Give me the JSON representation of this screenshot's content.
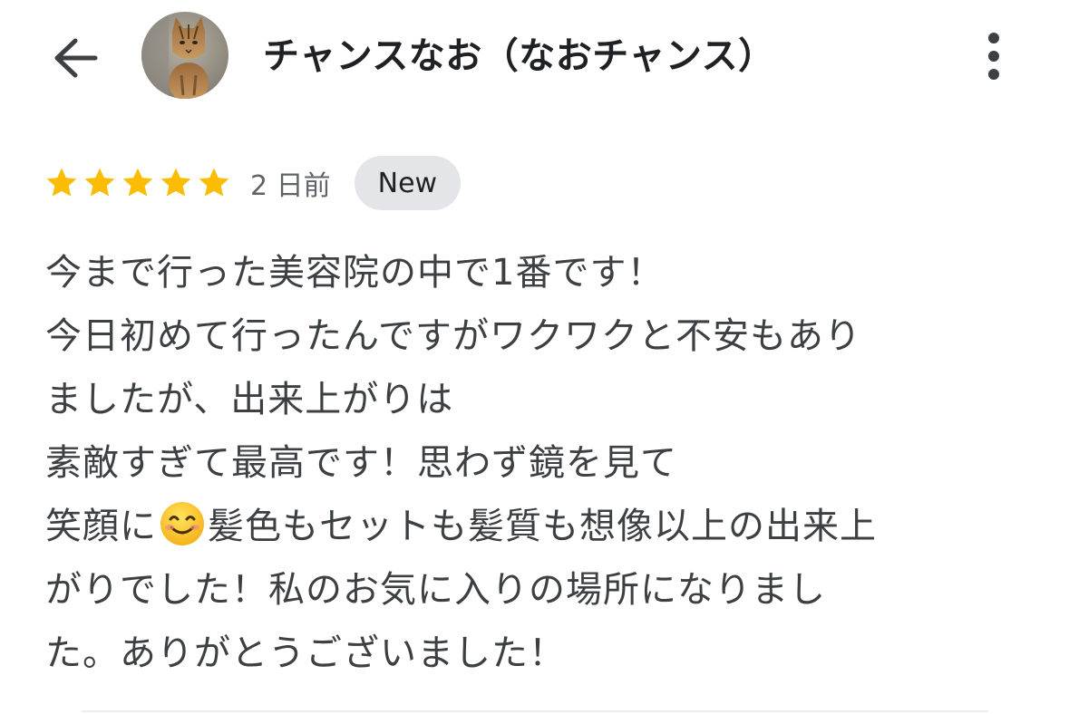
{
  "header": {
    "reviewer_name": "チャンスなお（なおチャンス）",
    "back_icon": "arrow-left-icon",
    "more_icon": "more-vert-icon",
    "avatar_icon": "cat-photo-avatar"
  },
  "review": {
    "rating": 5,
    "max_rating": 5,
    "star_color": "#fbbc04",
    "time_ago": "2 日前",
    "badge": "New",
    "lines": [
      {
        "text": "今まで行った美容院の中で1番です！"
      },
      {
        "text": "今日初めて行ったんですがワクワクと不安もあり"
      },
      {
        "text": "ましたが、出来上がりは"
      },
      {
        "text": "素敵すぎて最高です！思わず鏡を見て"
      },
      {
        "before": "笑顔に",
        "emoji": "😊",
        "after": "髪色もセットも髪質も想像以上の出来上"
      },
      {
        "text": "がりでした！私のお気に入りの場所になりまし"
      },
      {
        "text": "た。ありがとうございました！"
      }
    ]
  }
}
